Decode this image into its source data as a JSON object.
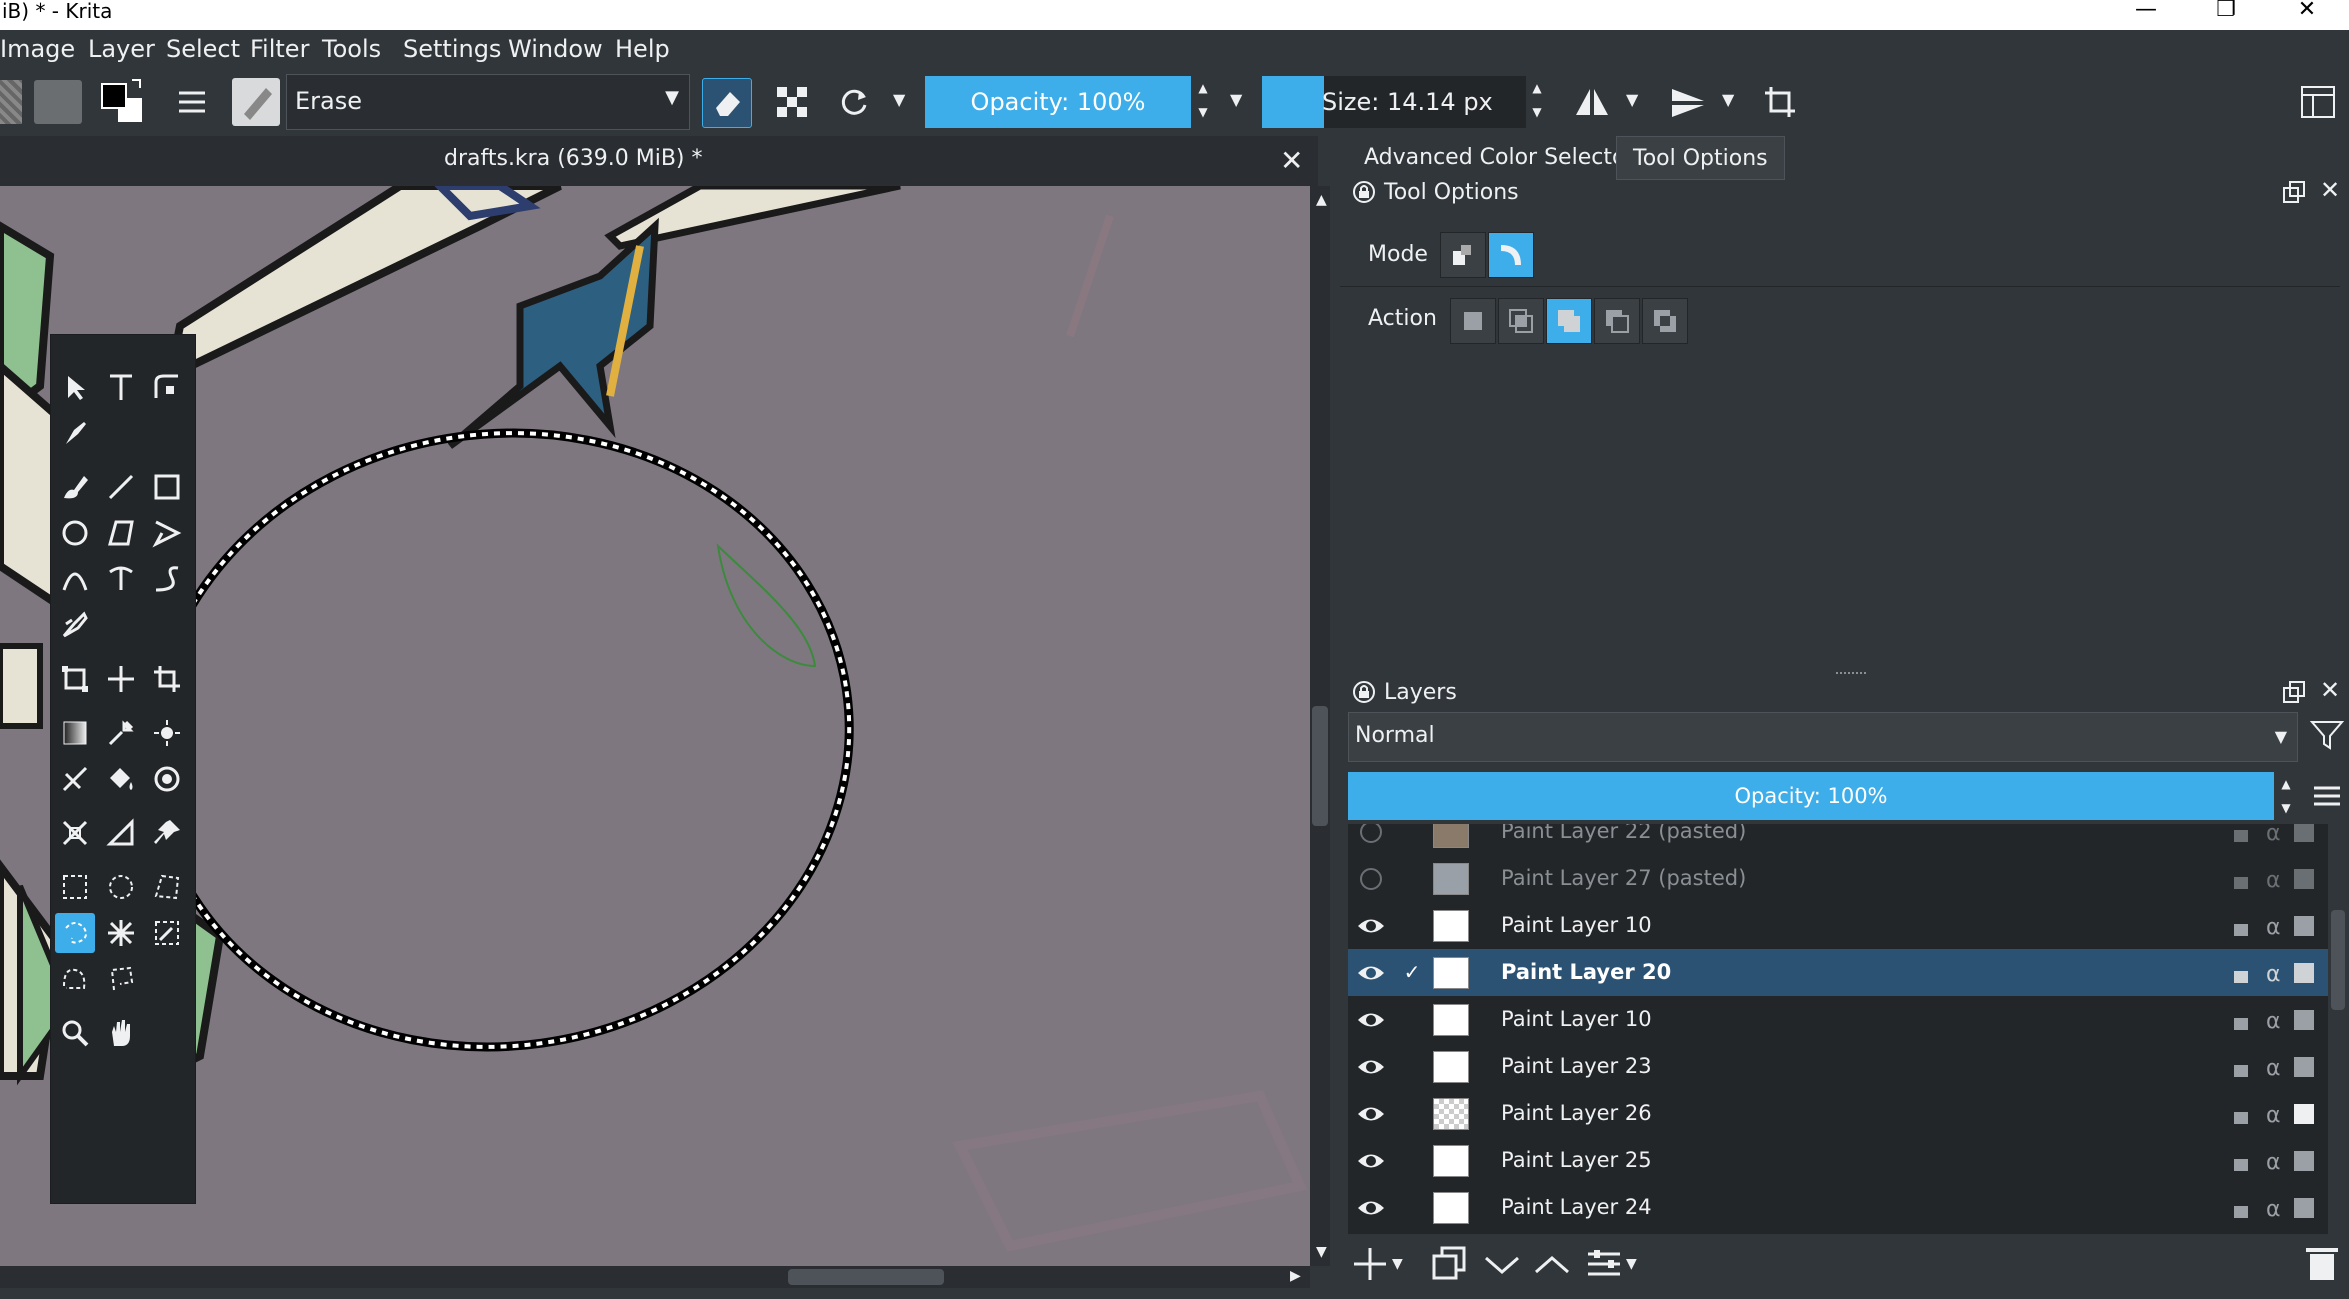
{
  "window": {
    "title": "iB) * - Krita"
  },
  "menubar": {
    "items": [
      {
        "label": "Image"
      },
      {
        "label": "Layer"
      },
      {
        "label": "Select"
      },
      {
        "label": "Filter"
      },
      {
        "label": "Tools"
      },
      {
        "label": "Settings"
      },
      {
        "label": "Window"
      },
      {
        "label": "Help"
      }
    ]
  },
  "toolbar": {
    "blend_mode": "Erase",
    "opacity": "Opacity: 100%",
    "size": "Size: 14.14 px"
  },
  "document": {
    "tab_title": "drafts.kra (639.0 MiB) *"
  },
  "dockers": {
    "tabs": [
      {
        "label": "Advanced Color Selector"
      },
      {
        "label": "Tool Options"
      }
    ],
    "tool_options": {
      "title": "Tool Options",
      "mode_label": "Mode",
      "action_label": "Action"
    },
    "layers": {
      "title": "Layers",
      "blend_mode": "Normal",
      "opacity": "Opacity:  100%",
      "items": [
        {
          "name": "Paint Layer 22 (pasted)",
          "visible": false,
          "selected": false
        },
        {
          "name": "Paint Layer 27 (pasted)",
          "visible": false,
          "selected": false
        },
        {
          "name": "Paint Layer 10",
          "visible": true,
          "selected": false
        },
        {
          "name": "Paint Layer 20",
          "visible": true,
          "selected": true
        },
        {
          "name": "Paint Layer 10",
          "visible": true,
          "selected": false
        },
        {
          "name": "Paint Layer 23",
          "visible": true,
          "selected": false
        },
        {
          "name": "Paint Layer 26",
          "visible": true,
          "selected": false
        },
        {
          "name": "Paint Layer 25",
          "visible": true,
          "selected": false
        },
        {
          "name": "Paint Layer 24",
          "visible": true,
          "selected": false
        }
      ]
    }
  },
  "colors": {
    "accent": "#3daee9",
    "window_bg": "#31363b",
    "canvas_bg": "#7e7780",
    "selected_row": "#2b5272"
  }
}
